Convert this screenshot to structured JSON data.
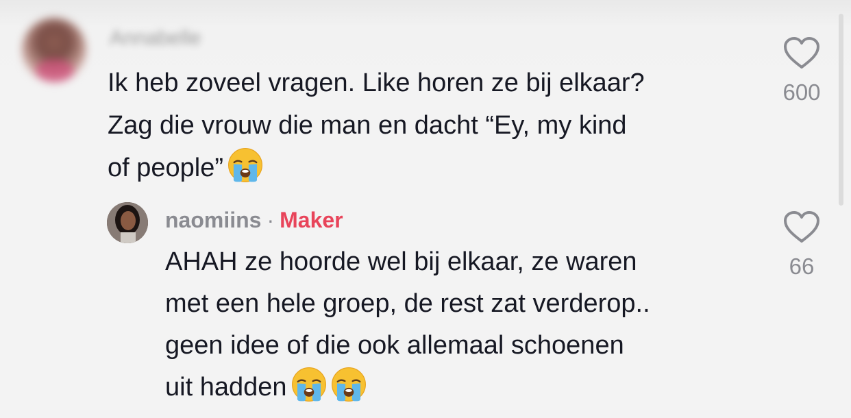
{
  "comment": {
    "username": "Annabelle",
    "text_line1": "Ik heb zoveel vragen. Like horen ze bij elkaar?",
    "text_line2": "Zag die vrouw die man en dacht “Ey, my kind",
    "text_line3": "of people”",
    "like_count": "600",
    "emoji": "loudly-crying-face"
  },
  "reply": {
    "username": "naomiins",
    "separator": "·",
    "badge": "Maker",
    "text_line1": "AHAH ze hoorde wel bij elkaar, ze waren",
    "text_line2": "met een hele groep, de rest zat verderop..",
    "text_line3": "geen idee of die ook allemaal schoenen",
    "text_line4": "uit hadden",
    "like_count": "66",
    "emoji": "loudly-crying-face"
  },
  "colors": {
    "text": "#161823",
    "muted": "#8a8b91",
    "maker_badge": "#e8445a",
    "background": "#f3f3f3"
  }
}
